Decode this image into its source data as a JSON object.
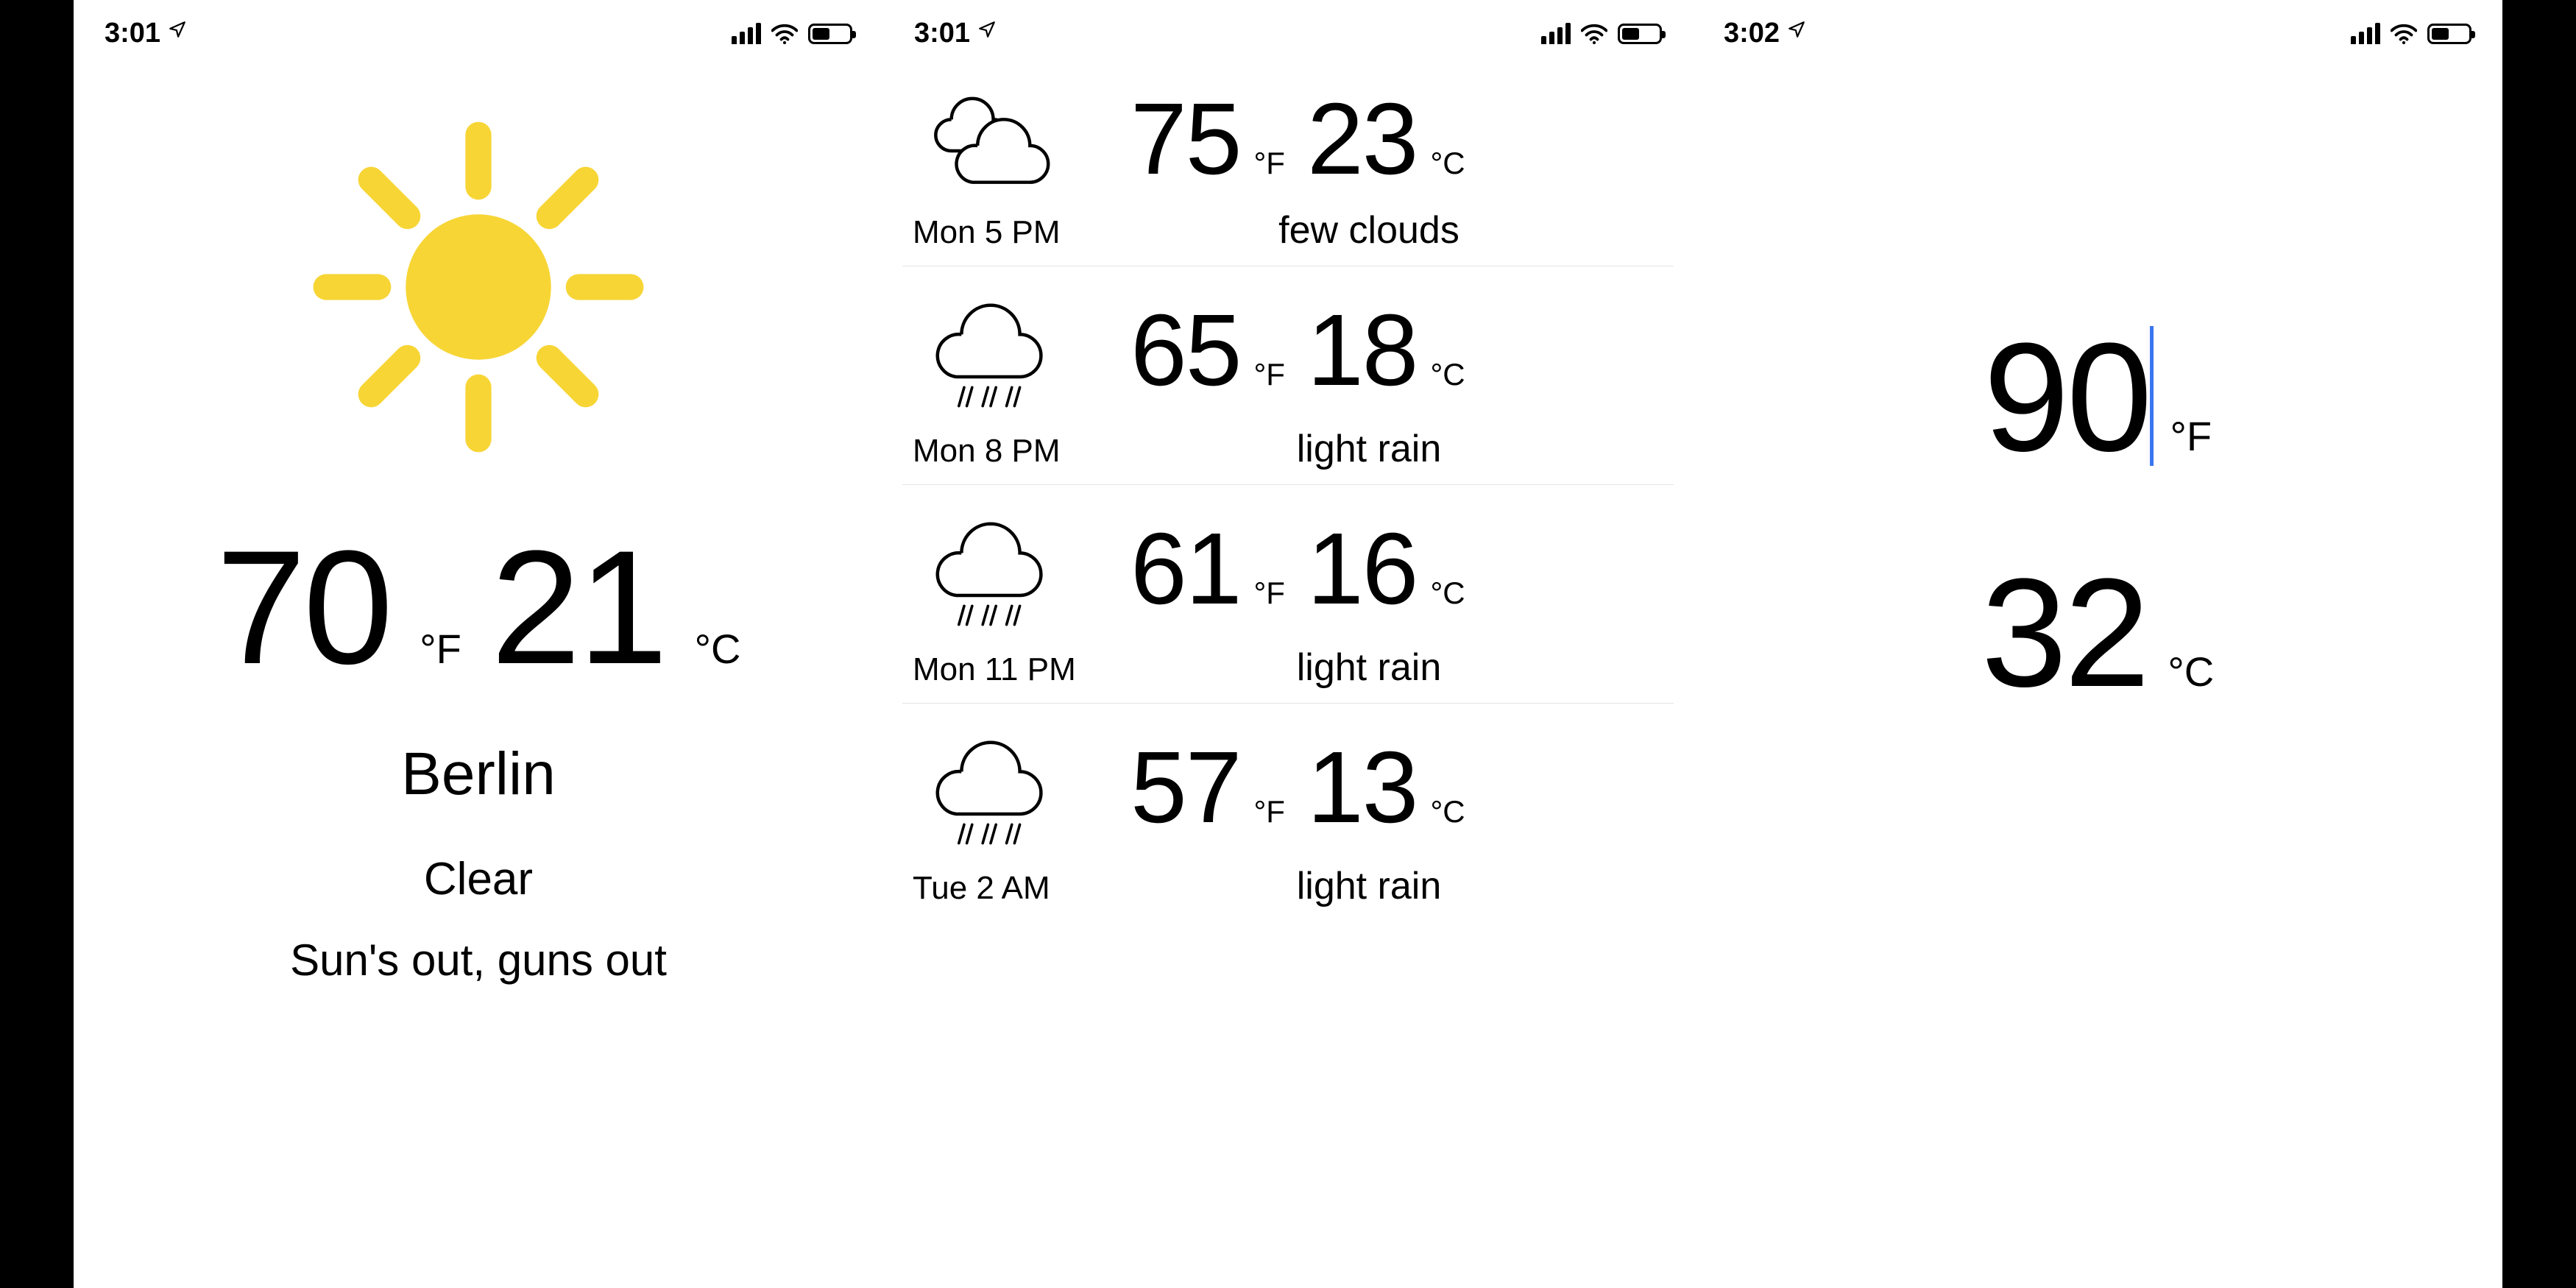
{
  "screens": [
    {
      "status": {
        "time": "3:01"
      },
      "current": {
        "temp_f": "70",
        "unit_f": "°F",
        "temp_c": "21",
        "unit_c": "°C",
        "city": "Berlin",
        "condition": "Clear",
        "quip": "Sun's out, guns out"
      }
    },
    {
      "status": {
        "time": "3:01"
      },
      "forecast": [
        {
          "icon": "few-clouds",
          "temp_f": "75",
          "unit_f": "°F",
          "temp_c": "23",
          "unit_c": "°C",
          "time": "Mon 5 PM",
          "desc": "few clouds"
        },
        {
          "icon": "rain",
          "temp_f": "65",
          "unit_f": "°F",
          "temp_c": "18",
          "unit_c": "°C",
          "time": "Mon 8 PM",
          "desc": "light rain"
        },
        {
          "icon": "rain",
          "temp_f": "61",
          "unit_f": "°F",
          "temp_c": "16",
          "unit_c": "°C",
          "time": "Mon 11 PM",
          "desc": "light rain"
        },
        {
          "icon": "rain",
          "temp_f": "57",
          "unit_f": "°F",
          "temp_c": "13",
          "unit_c": "°C",
          "time": "Tue 2 AM",
          "desc": "light rain"
        }
      ]
    },
    {
      "status": {
        "time": "3:02"
      },
      "editor": {
        "value_f": "90",
        "unit_f": "°F",
        "value_c": "32",
        "unit_c": "°C"
      }
    }
  ]
}
